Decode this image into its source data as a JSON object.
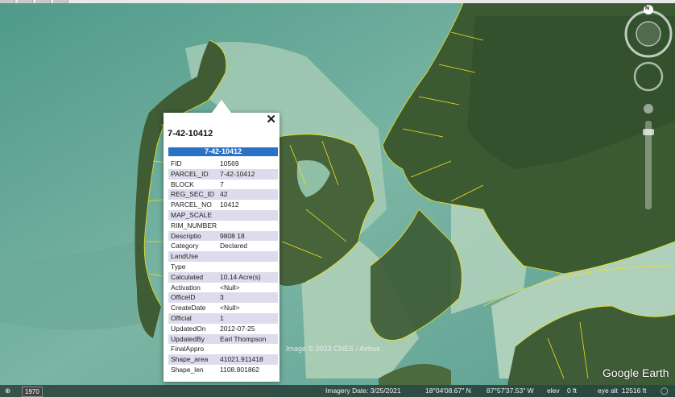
{
  "popup": {
    "title": "7-42-10412",
    "table_header": "7-42-10412",
    "close_label": "✕",
    "rows": [
      {
        "key": "FID",
        "value": "10569"
      },
      {
        "key": "PARCEL_ID",
        "value": "7-42-10412"
      },
      {
        "key": "BLOCK",
        "value": "7"
      },
      {
        "key": "REG_SEC_ID",
        "value": "42"
      },
      {
        "key": "PARCEL_NO",
        "value": "10412"
      },
      {
        "key": "MAP_SCALE",
        "value": ""
      },
      {
        "key": "RIM_NUMBER",
        "value": ""
      },
      {
        "key": "Descriptio",
        "value": "9808 18"
      },
      {
        "key": "Category",
        "value": "Declared"
      },
      {
        "key": "LandUse",
        "value": ""
      },
      {
        "key": "Type",
        "value": ""
      },
      {
        "key": "Calculated",
        "value": "10.14 Acre(s)"
      },
      {
        "key": "Activation",
        "value": "<Null>"
      },
      {
        "key": "OfficeID",
        "value": "3"
      },
      {
        "key": "CreateDate",
        "value": "<Null>"
      },
      {
        "key": "Official",
        "value": "1"
      },
      {
        "key": "UpdatedOn",
        "value": "2012-07-25"
      },
      {
        "key": "UpdatedBy",
        "value": "Earl Thompson"
      },
      {
        "key": "FinalAppro",
        "value": ""
      },
      {
        "key": "Shape_area",
        "value": "41021.911418"
      },
      {
        "key": "Shape_len",
        "value": "1108.801862"
      }
    ]
  },
  "map": {
    "watermark": "Image © 2023 CNES / Airbus",
    "brand": "Google Earth",
    "compass_north": "N"
  },
  "status": {
    "year": "1970",
    "imagery_date": "Imagery Date: 3/25/2021",
    "lat": "18°04'08.67\" N",
    "lon": "87°57'37.53\" W",
    "elev": "elev    0 ft",
    "eye_alt": "eye alt  12516 ft"
  },
  "colors": {
    "water": "#6fae9f",
    "shallow": "#b9d3b8",
    "land": "#3a5a2e",
    "parcel_line": "#f2e21a"
  }
}
